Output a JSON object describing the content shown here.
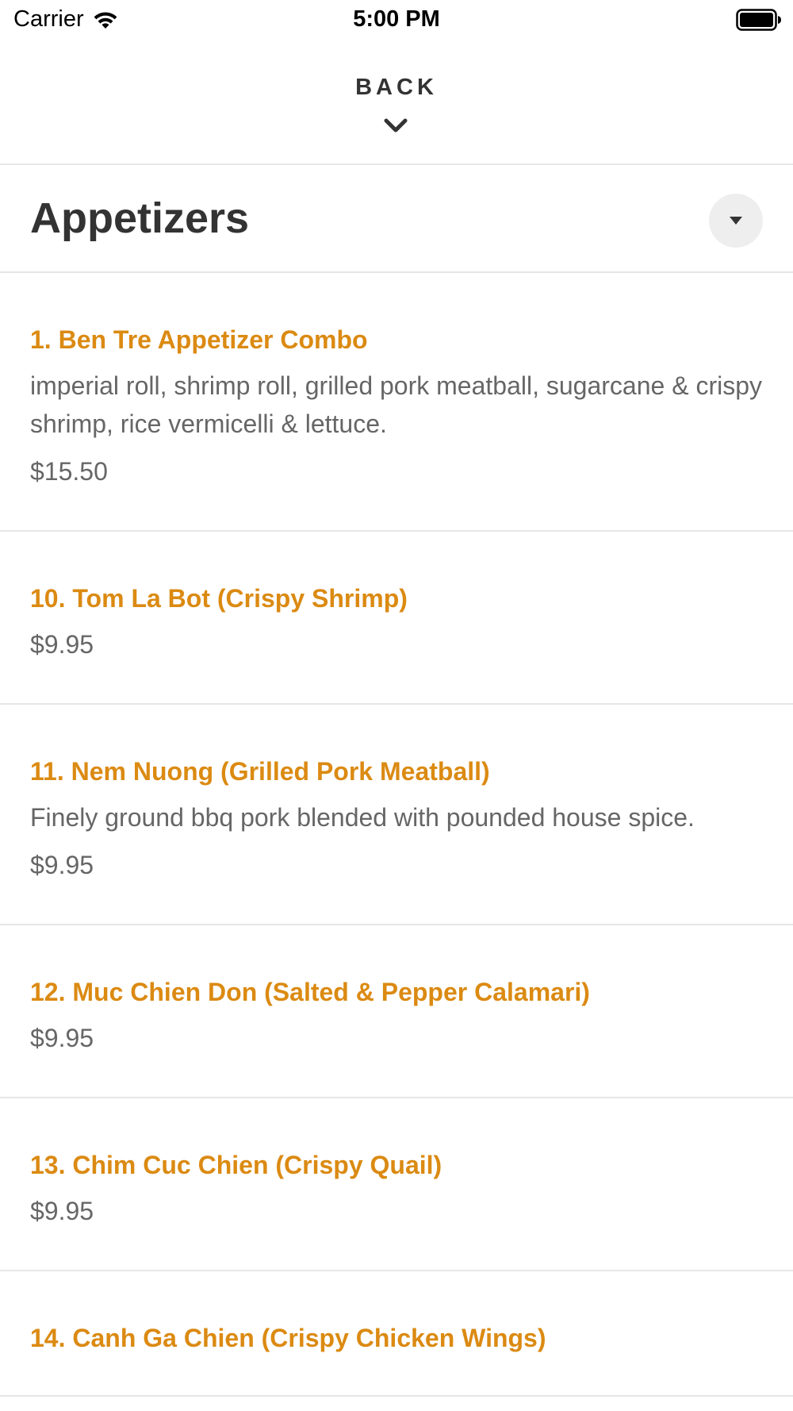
{
  "status_bar": {
    "carrier": "Carrier",
    "time": "5:00 PM"
  },
  "header": {
    "back_label": "BACK"
  },
  "category": {
    "title": "Appetizers"
  },
  "menu_items": [
    {
      "name": "1. Ben Tre Appetizer Combo",
      "description": "imperial roll, shrimp roll, grilled pork meatball, sugarcane & crispy shrimp, rice vermicelli & lettuce.",
      "price": "$15.50"
    },
    {
      "name": "10. Tom La Bot (Crispy Shrimp)",
      "description": "",
      "price": "$9.95"
    },
    {
      "name": "11. Nem Nuong (Grilled Pork Meatball)",
      "description": "Finely ground bbq pork blended with pounded house spice.",
      "price": "$9.95"
    },
    {
      "name": "12. Muc Chien Don (Salted & Pepper Calamari)",
      "description": "",
      "price": "$9.95"
    },
    {
      "name": "13. Chim Cuc Chien (Crispy Quail)",
      "description": "",
      "price": "$9.95"
    },
    {
      "name": "14. Canh Ga Chien (Crispy Chicken Wings)",
      "description": "",
      "price": ""
    }
  ],
  "colors": {
    "accent": "#db8a12",
    "text_primary": "#333333",
    "text_secondary": "#666666",
    "divider": "#e6e6e6"
  }
}
